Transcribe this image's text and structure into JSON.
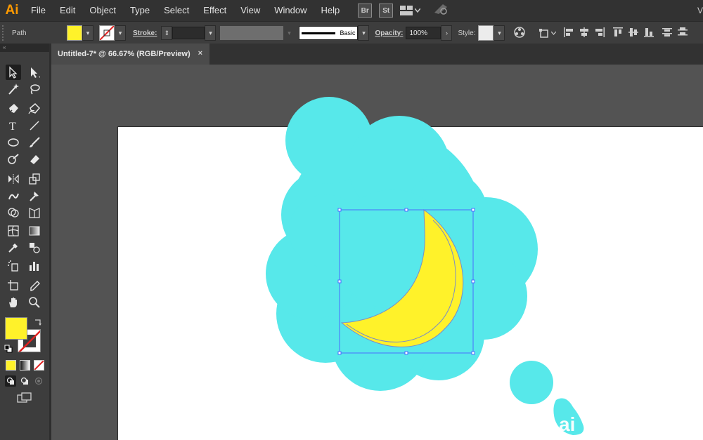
{
  "app": {
    "logo": "Ai"
  },
  "menu": [
    "File",
    "Edit",
    "Object",
    "Type",
    "Select",
    "Effect",
    "View",
    "Window",
    "Help"
  ],
  "bridge": {
    "br": "Br",
    "st": "St"
  },
  "control": {
    "object_type": "Path",
    "fill_color": "#fff22a",
    "stroke_label": "Stroke:",
    "brush_label": "Basic",
    "opacity_label": "Opacity:",
    "opacity_value": "100%",
    "style_label": "Style:"
  },
  "document": {
    "tab_title": "Untitled-7* @ 66.67% (RGB/Preview)",
    "close": "×"
  },
  "colors": {
    "cloud": "#57e8ea",
    "banana": "#fff22a",
    "selection": "#4a6cff",
    "fill_swatch": "#fff22a"
  },
  "watermark": "ai"
}
